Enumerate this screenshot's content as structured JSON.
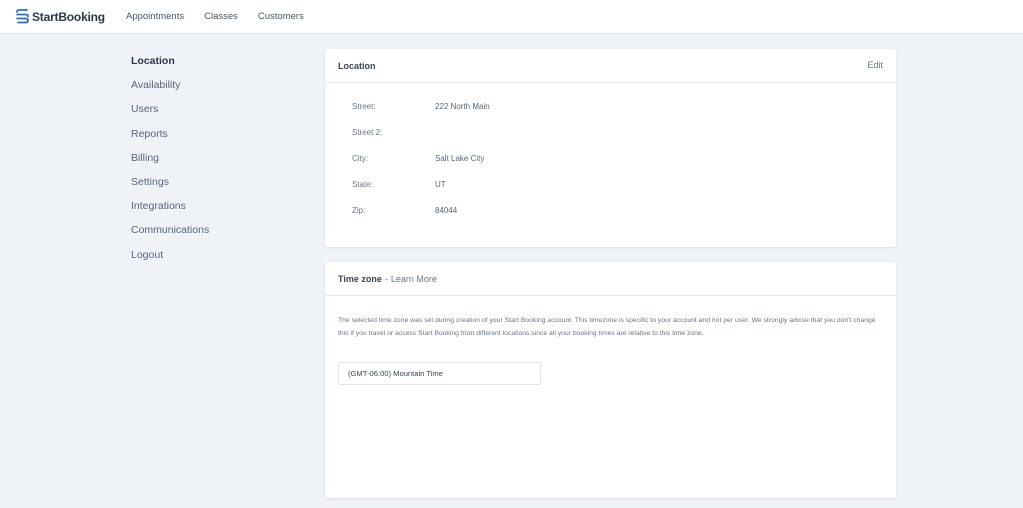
{
  "brand": {
    "name": "StartBooking",
    "color": "#2a6fd6",
    "icon": "startbooking-logo-icon"
  },
  "topnav": {
    "items": [
      {
        "label": "Appointments"
      },
      {
        "label": "Classes"
      },
      {
        "label": "Customers"
      }
    ]
  },
  "sidebar": {
    "items": [
      {
        "label": "Location",
        "active": true
      },
      {
        "label": "Availability"
      },
      {
        "label": "Users"
      },
      {
        "label": "Reports"
      },
      {
        "label": "Billing"
      },
      {
        "label": "Settings"
      },
      {
        "label": "Integrations"
      },
      {
        "label": "Communications"
      },
      {
        "label": "Logout"
      }
    ]
  },
  "location_card": {
    "title": "Location",
    "edit_label": "Edit",
    "fields": [
      {
        "label": "Street:",
        "value": "222 North Main"
      },
      {
        "label": "Street 2:",
        "value": ""
      },
      {
        "label": "City:",
        "value": "Salt Lake City"
      },
      {
        "label": "State:",
        "value": "UT"
      },
      {
        "label": "Zip:",
        "value": "84044"
      }
    ]
  },
  "timezone_card": {
    "title": "Time zone",
    "separator": "-",
    "learn_more": "Learn More",
    "description": "The selected time zone was set during creation of your Start Booking account. This timezone is specific to your account and not per user. We strongly advise that you don't change this if you travel or access Start Booking from different locations since all your booking times are relative to this time zone.",
    "selected": "(GMT-06:00) Mountain Time"
  }
}
